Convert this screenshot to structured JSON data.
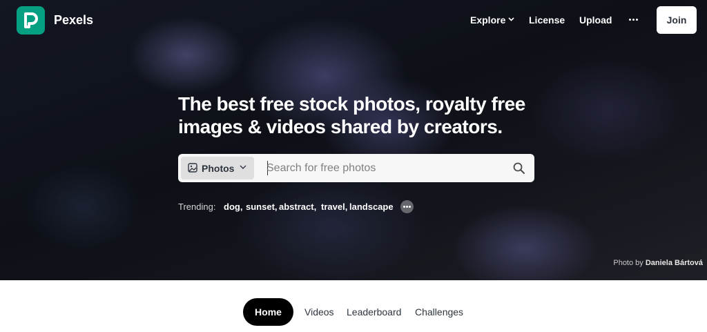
{
  "brand": {
    "name": "Pexels",
    "color": "#05a081"
  },
  "nav": {
    "explore": "Explore",
    "license": "License",
    "upload": "Upload",
    "more_icon": "ellipsis-icon",
    "join": "Join"
  },
  "hero": {
    "headline": "The best free stock photos, royalty free images & videos shared by creators.",
    "search": {
      "type_label": "Photos",
      "placeholder": "Search for free photos",
      "value": ""
    },
    "trending": {
      "label": "Trending:",
      "items": [
        "dog,",
        "sunset,",
        "abstract,",
        "travel,",
        "landscape"
      ]
    },
    "credit": {
      "prefix": "Photo by",
      "author": "Daniela Bártová"
    }
  },
  "tabs": {
    "active": "Home",
    "items": [
      "Videos",
      "Leaderboard",
      "Challenges"
    ]
  }
}
